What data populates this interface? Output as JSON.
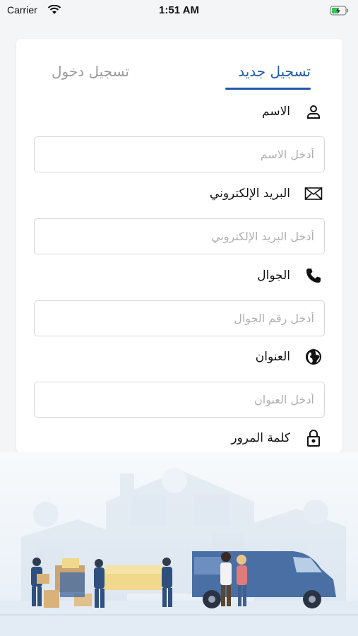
{
  "status_bar": {
    "carrier": "Carrier",
    "time": "1:51 AM"
  },
  "tabs": {
    "signup": "تسجيل جديد",
    "login": "تسجيل دخول"
  },
  "fields": [
    {
      "label": "الاسم",
      "placeholder": "أدخل الاسم",
      "icon": "user-icon"
    },
    {
      "label": "البريد الإلكتروني",
      "placeholder": "أدخل البريد الإلكتروني",
      "icon": "mail-icon"
    },
    {
      "label": "الجوال",
      "placeholder": "أدخل رقم الجوال",
      "icon": "phone-icon"
    },
    {
      "label": "العنوان",
      "placeholder": "أدخل العنوان",
      "icon": "globe-icon"
    },
    {
      "label": "كلمة المرور",
      "icon": "lock-icon"
    }
  ],
  "colors": {
    "accent": "#1f5ba8",
    "inactive_tab": "#9a9a9a",
    "border": "#d8d8d8"
  }
}
